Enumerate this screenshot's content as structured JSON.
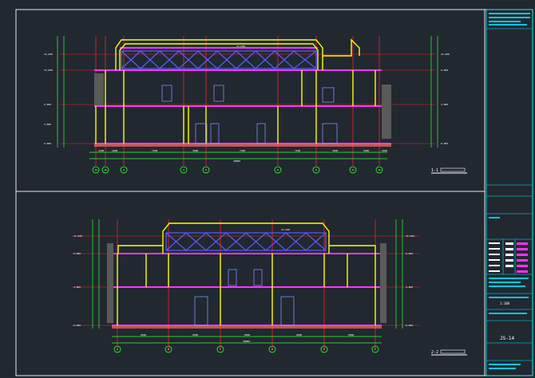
{
  "drawing": {
    "section_1": {
      "title": "1-1",
      "grid_labels": [
        "1a",
        "1b",
        "2",
        "4",
        "5",
        "8",
        "9",
        "11",
        "12"
      ],
      "roof_elevation": "14.600",
      "level_marks_left": [
        "14.600",
        "13.800",
        "9.600",
        "4.800",
        "0.000"
      ],
      "level_marks_right": [
        "14.600",
        "9.600",
        "4.800",
        "0.000"
      ],
      "dims_bottom": [
        "1500",
        "1800",
        "7200",
        "3600",
        "7200",
        "7200",
        "3600",
        "5800",
        "2400"
      ],
      "overall": "40800",
      "ground_mark": "-0.450"
    },
    "section_2": {
      "title": "2-2",
      "grid_labels": [
        "A",
        "B",
        "C",
        "D",
        "E",
        "F"
      ],
      "roof_elevation": "14.600",
      "level_marks_left": [
        "14.600",
        "9.600",
        "4.800",
        "0.000"
      ],
      "level_marks_right": [
        "14.600",
        "9.600",
        "4.800",
        "0.000"
      ],
      "dims_bottom": [
        "6000",
        "6000",
        "6000",
        "6000",
        "6000"
      ],
      "overall": "30000",
      "ground_mark": "-0.450"
    },
    "title_block": {
      "scale": "1:100",
      "sheet": "JS-14"
    }
  },
  "colors": {
    "background": "#212830",
    "frame": "#e8e8e8",
    "structure": "#ffff00",
    "truss": "#5b5bff",
    "floor": "#ff33ff",
    "gridline": "#ff2020",
    "dimension": "#33ff33",
    "title_block": "#00e5ff"
  }
}
